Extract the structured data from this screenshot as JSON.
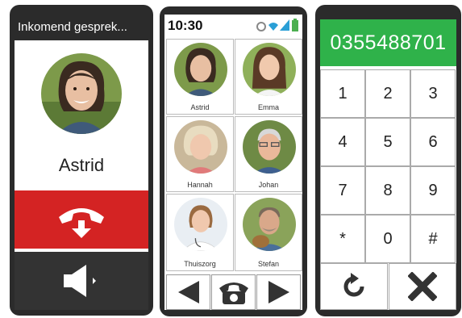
{
  "incoming_call": {
    "title": "Inkomend gesprek...",
    "caller_name": "Astrid",
    "decline_icon": "hang-up-phone-icon",
    "speaker_icon": "speaker-icon",
    "colors": {
      "decline": "#d42323",
      "speaker": "#333333"
    }
  },
  "contacts_screen": {
    "status_time": "10:30",
    "status_icons": [
      "settings-icon",
      "wifi-icon",
      "signal-icon",
      "battery-icon"
    ],
    "contacts": [
      {
        "name": "Astrid"
      },
      {
        "name": "Emma"
      },
      {
        "name": "Hannah"
      },
      {
        "name": "Johan"
      },
      {
        "name": "Thuiszorg"
      },
      {
        "name": "Stefan"
      }
    ],
    "nav": [
      "back-arrow-icon",
      "phone-icon",
      "forward-arrow-icon"
    ]
  },
  "dialer": {
    "number": "0355488701",
    "keys": [
      "1",
      "2",
      "3",
      "4",
      "5",
      "6",
      "7",
      "8",
      "9",
      "*",
      "0",
      "#"
    ],
    "actions": [
      "undo-icon",
      "close-icon"
    ],
    "colors": {
      "number_bar": "#2fb24a"
    }
  }
}
